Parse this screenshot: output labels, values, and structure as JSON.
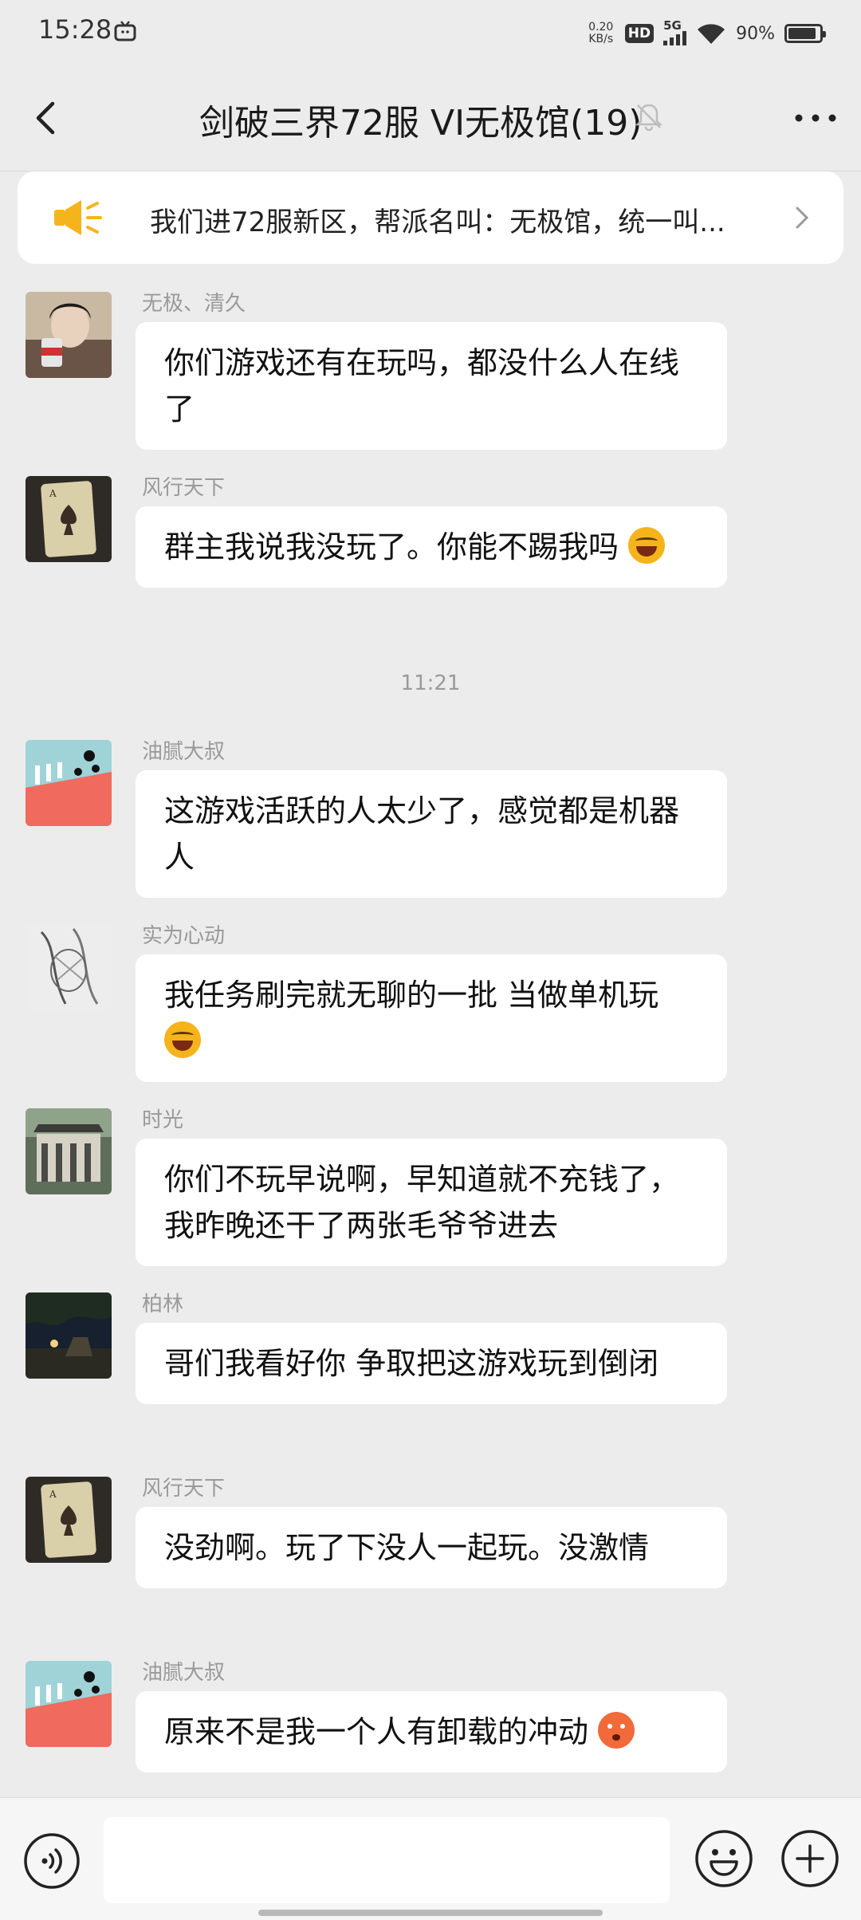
{
  "status_bar": {
    "time": "15:28",
    "net_speed_value": "0.20",
    "net_speed_unit": "KB/s",
    "hd": "HD",
    "network": "5G",
    "battery_pct": "90%",
    "battery_level": 0.9
  },
  "header": {
    "title": "剑破三界72服 VI无极馆(19)",
    "icons": [
      "back-icon",
      "bell-muted-icon",
      "more-icon"
    ]
  },
  "announcement": {
    "text": "我们进72服新区，帮派名叫：无极馆，统一叫...",
    "icon": "speaker-icon"
  },
  "messages": [
    {
      "sender": "无极、清久",
      "text": "你们游戏还有在玩吗，都没什么人在线了",
      "emoji": ""
    },
    {
      "sender": "风行天下",
      "text": "群主我说我没玩了。你能不踢我吗",
      "emoji": "laugh-cry"
    },
    {
      "sender": "油腻大叔",
      "text": "这游戏活跃的人太少了，感觉都是机器人",
      "emoji": ""
    },
    {
      "sender": "实为心动",
      "text": "我任务刷完就无聊的一批 当做单机玩",
      "emoji": "laugh-cry"
    },
    {
      "sender": "时光",
      "text": "你们不玩早说啊，早知道就不充钱了，我昨晚还干了两张毛爷爷进去",
      "emoji": ""
    },
    {
      "sender": "柏林",
      "text": "哥们我看好你 争取把这游戏玩到倒闭",
      "emoji": ""
    },
    {
      "sender": "风行天下",
      "text": "没劲啊。玩了下没人一起玩。没激情",
      "emoji": ""
    },
    {
      "sender": "油腻大叔",
      "text": "原来不是我一个人有卸载的冲动",
      "emoji": "flushed"
    }
  ],
  "time_divider": "11:21",
  "input_bar": {
    "value": "",
    "icons": [
      "voice-icon",
      "emoji-icon",
      "plus-icon"
    ]
  },
  "colors": {
    "background": "#ececec",
    "bubble": "#ffffff",
    "speaker_accent": "#f5b41c",
    "avatar_pink": "#f06a5e",
    "avatar_sky": "#9fd3d8"
  }
}
